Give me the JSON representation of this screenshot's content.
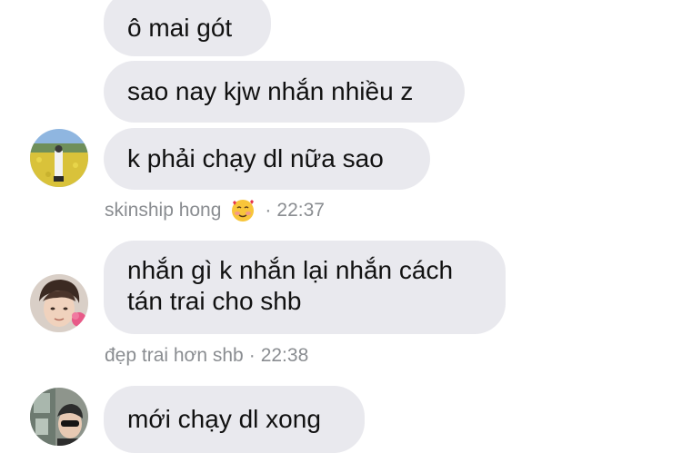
{
  "messages": [
    {
      "text": "ô mai gót"
    },
    {
      "text": "sao nay kjw nhắn nhiều z"
    },
    {
      "text": "k phải chạy dl nữa sao"
    },
    {
      "text": "nhắn gì k nhắn lại nhắn cách tán trai cho shb"
    },
    {
      "text": "mới chạy dl xong"
    }
  ],
  "meta": [
    {
      "sender": "skinship hong",
      "separator": "·",
      "time": "22:37",
      "emoji": "smiling-face-with-hearts"
    },
    {
      "sender": "đẹp trai hơn shb",
      "separator": "·",
      "time": "22:38"
    }
  ],
  "avatars": [
    {
      "name": "skinship-hong-avatar"
    },
    {
      "name": "dep-trai-hon-shb-avatar"
    },
    {
      "name": "third-user-avatar"
    }
  ],
  "colors": {
    "bubble_background": "#e9e9ee",
    "meta_text": "#8a8d91",
    "message_text": "#111111"
  }
}
